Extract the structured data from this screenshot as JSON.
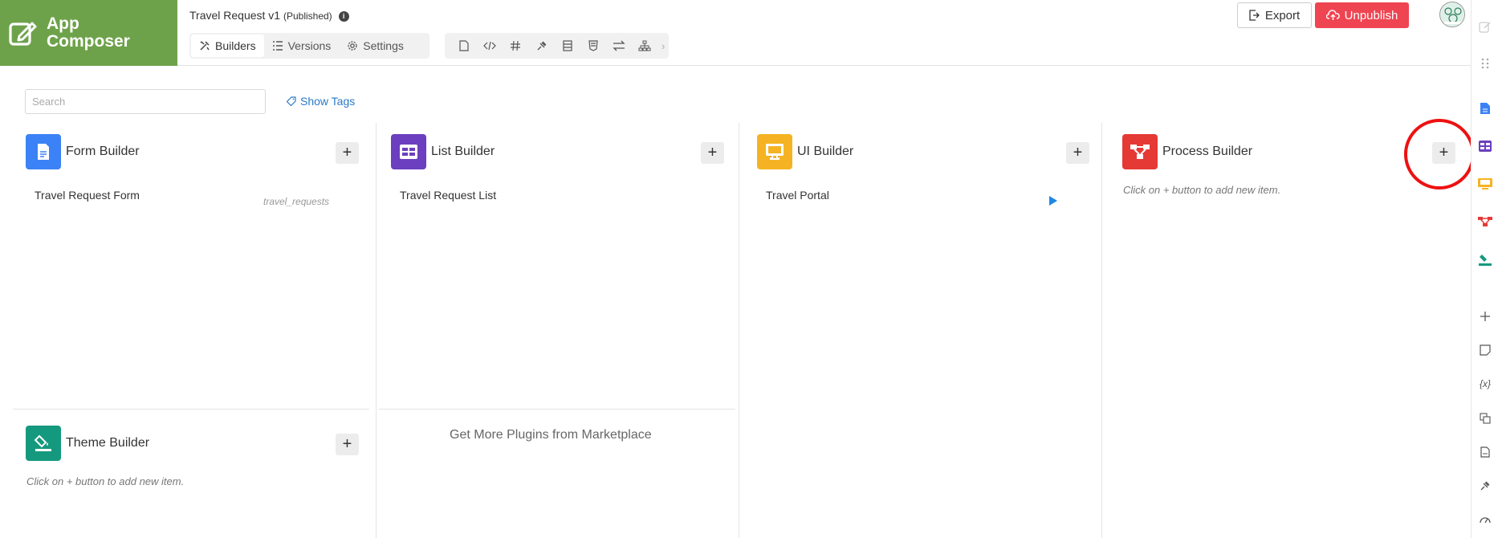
{
  "logo": {
    "line1": "App",
    "line2": "Composer"
  },
  "app": {
    "name": "Travel Request v1",
    "status": "(Published)"
  },
  "tabs": [
    {
      "label": "Builders",
      "icon": "builders-icon"
    },
    {
      "label": "Versions",
      "icon": "versions-icon"
    },
    {
      "label": "Settings",
      "icon": "gear-icon"
    }
  ],
  "toolbar_icons": [
    "file-icon",
    "code-icon",
    "hash-icon",
    "plugin-icon",
    "database-icon",
    "shield-icon",
    "swap-icon",
    "sitemap-icon"
  ],
  "actions": {
    "export": "Export",
    "unpublish": "Unpublish"
  },
  "search": {
    "placeholder": "Search",
    "value": ""
  },
  "show_tags": "Show Tags",
  "builders": {
    "form": {
      "title": "Form Builder",
      "items": [
        {
          "name": "Travel Request Form",
          "tag": "travel_requests"
        }
      ]
    },
    "list": {
      "title": "List Builder",
      "items": [
        {
          "name": "Travel Request List"
        }
      ]
    },
    "ui": {
      "title": "UI Builder",
      "items": [
        {
          "name": "Travel Portal"
        }
      ]
    },
    "process": {
      "title": "Process Builder",
      "empty": "Click on + button to add new item."
    },
    "theme": {
      "title": "Theme Builder",
      "empty": "Click on + button to add new item."
    }
  },
  "marketplace": "Get More Plugins from Marketplace",
  "colors": {
    "logo_bg": "#6ea24a",
    "form": "#3b82f6",
    "list": "#6b3fbf",
    "ui": "#f5b324",
    "process": "#e53935",
    "theme": "#14997e",
    "unpublish": "#ef4451",
    "link": "#2a7ac7",
    "highlight": "#ee1111"
  },
  "sidebar_icons": [
    "edit-icon",
    "drag-icon",
    "form-icon",
    "list-icon",
    "ui-icon",
    "process-icon",
    "theme-icon",
    "plus-icon",
    "note-icon",
    "variable-icon",
    "translate-icon",
    "pdf-icon",
    "plugin-icon",
    "performance-icon"
  ]
}
